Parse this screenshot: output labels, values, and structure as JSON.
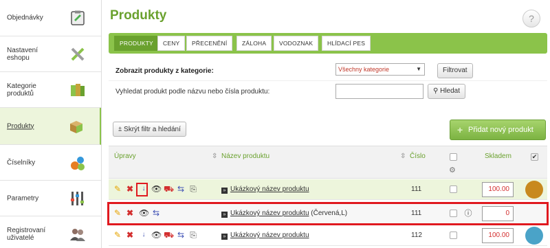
{
  "sidebar": {
    "items": [
      {
        "label": "Objednávky",
        "icon": "clipboard-icon"
      },
      {
        "label": "Nastavení\neshopu",
        "icon": "tools-icon"
      },
      {
        "label": "Kategorie\nproduktů",
        "icon": "books-icon"
      },
      {
        "label": "Produkty",
        "icon": "box-icon"
      },
      {
        "label": "Číselníky",
        "icon": "numbers-icon"
      },
      {
        "label": "Parametry",
        "icon": "sliders-icon"
      },
      {
        "label": "Registrovaní\nuživatelé",
        "icon": "users-icon"
      }
    ]
  },
  "page": {
    "title": "Produkty",
    "help": "?"
  },
  "tabs": [
    "PRODUKTY",
    "CENY",
    "PŘECENĚNÍ",
    "ZÁLOHA",
    "VODOZNAK",
    "HLÍDACÍ PES"
  ],
  "filter": {
    "category_label": "Zobrazit produkty z kategorie:",
    "category_value": "Všechny kategorie",
    "filter_button": "Filtrovat",
    "search_label": "Vyhledat produkt podle názvu nebo čísla produktu:",
    "search_value": "",
    "search_button": "Hledat"
  },
  "toolbar": {
    "hide_filter": "Skrýt filtr a hledání",
    "add_product": "Přidat nový produkt"
  },
  "table": {
    "headers": {
      "actions": "Úpravy",
      "name": "Název produktu",
      "number": "Číslo",
      "stock": "Skladem"
    },
    "rows": [
      {
        "name": "Ukázkový název produktu",
        "variant": "",
        "number": "111",
        "stock": "100.00"
      },
      {
        "name": "Ukázkový název produktu",
        "variant": "(Červená,L)",
        "number": "111",
        "stock": "0"
      },
      {
        "name": "Ukázkový název produktu",
        "variant": "",
        "number": "112",
        "stock": "100.00"
      }
    ]
  },
  "colors": {
    "accent": "#8bc34a",
    "title": "#6aa12e",
    "highlight_box": "#e0191f"
  }
}
